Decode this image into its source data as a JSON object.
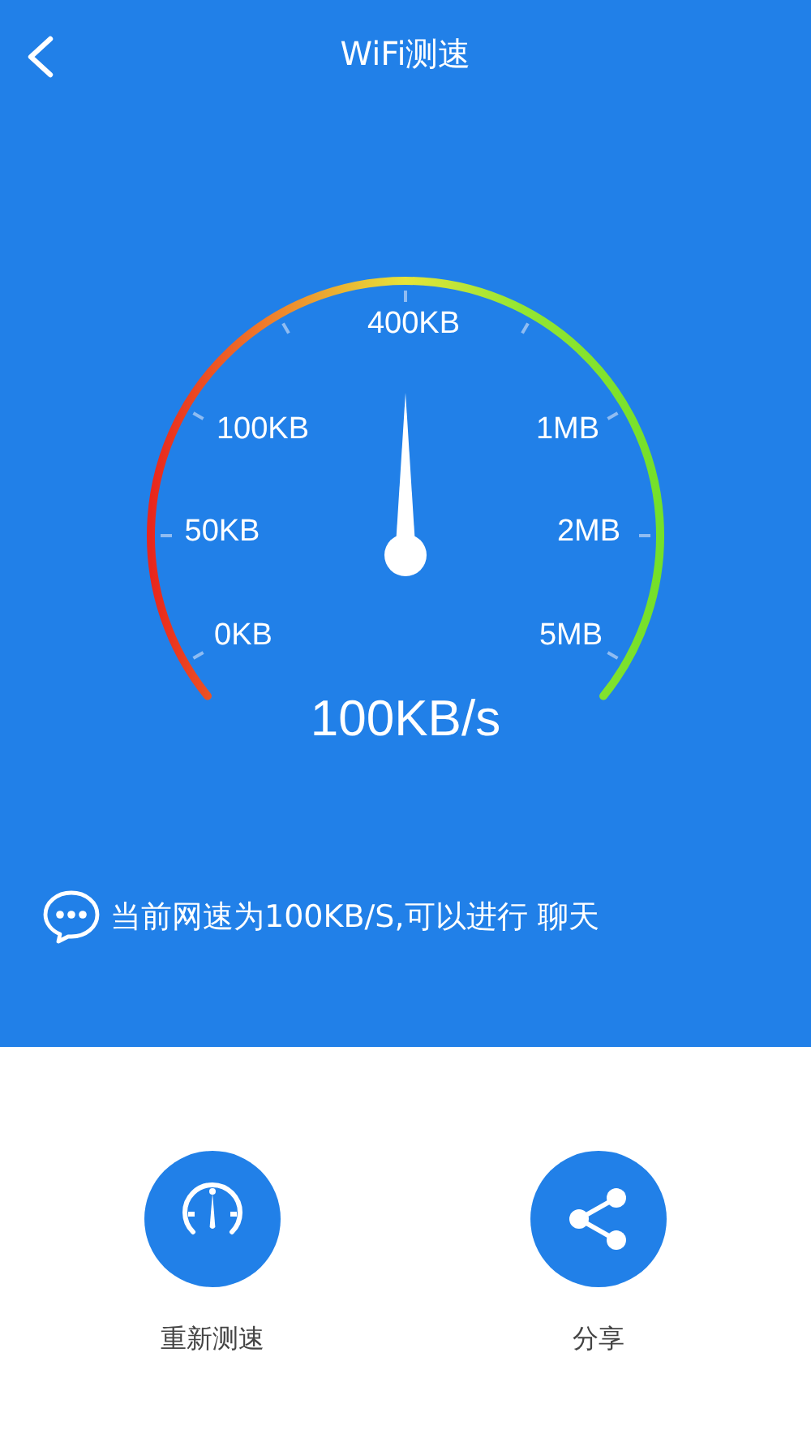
{
  "header": {
    "title": "WiFi测速"
  },
  "gauge": {
    "scale_labels": [
      "400KB",
      "100KB",
      "1MB",
      "50KB",
      "2MB",
      "0KB",
      "5MB"
    ],
    "reading": "100KB/s"
  },
  "message": "当前网速为100KB/S,可以进行 聊天",
  "actions": [
    {
      "kind": "retest",
      "label": "重新测速"
    },
    {
      "kind": "share",
      "label": "分享"
    }
  ]
}
